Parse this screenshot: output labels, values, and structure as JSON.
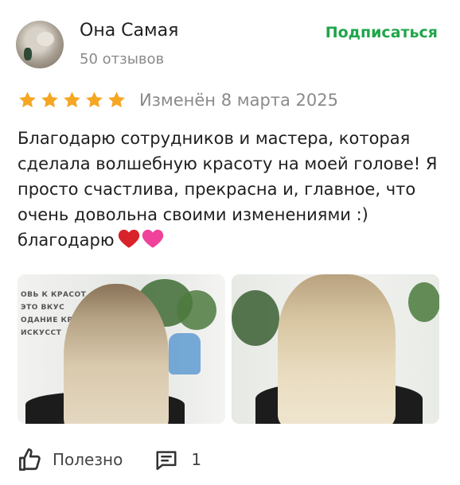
{
  "review": {
    "author": "Она Самая",
    "reviews_count": "50 отзывов",
    "subscribe_label": "Подписаться",
    "rating": 5,
    "rating_max": 5,
    "date": "Изменён 8 марта 2025",
    "text": "Благодарю сотрудников и мастера, которая сделала волшебную красоту на моей голове! Я просто счастлива, прекрасна и, главное, что очень довольна своими изменениями :) благодарю",
    "emojis": [
      "red-heart",
      "pink-heart"
    ],
    "photos": [
      {
        "name": "hair-photo-before",
        "sign_text": [
          "ОВЬ К КРАСОТ",
          "ЭТО ВКУС",
          "ОДАНИЕ КРА",
          "ИСКУССТ"
        ]
      },
      {
        "name": "hair-photo-after"
      }
    ]
  },
  "footer": {
    "useful_label": "Полезно",
    "comments_count": "1"
  },
  "colors": {
    "accent_green": "#1fa64a",
    "star": "#f5a623",
    "muted_text": "#8a8a8a"
  }
}
